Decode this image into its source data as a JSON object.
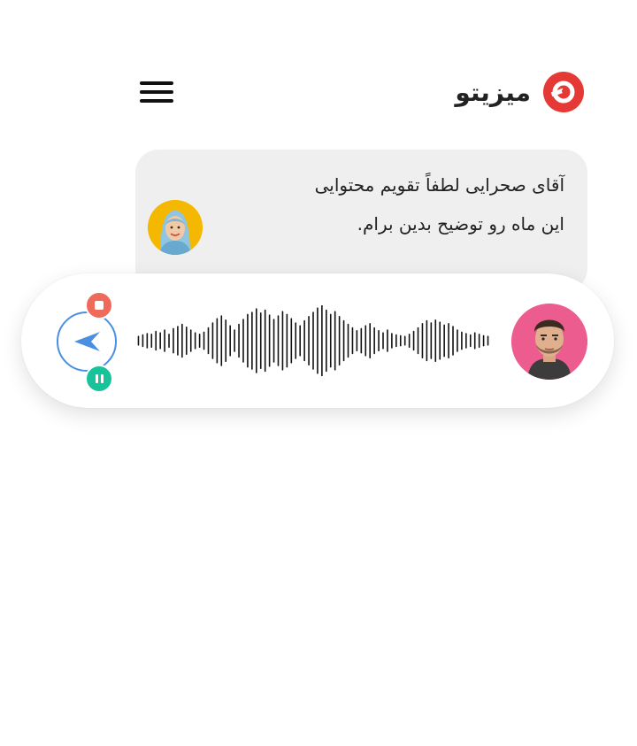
{
  "header": {
    "brand_name": "میزیتو",
    "menu_icon": "hamburger-menu-icon",
    "logo_icon": "mizito-logo-icon",
    "brand_color": "#e53935"
  },
  "message": {
    "line1": "آقای صحرایی لطفاً تقویم محتوایی",
    "line2": "این ماه رو توضیح بدین برام.",
    "avatar_icon": "woman-hijab-avatar",
    "bubble_color": "#efefef"
  },
  "recorder": {
    "send_icon": "send-arrow-icon",
    "stop_icon": "stop-icon",
    "pause_icon": "pause-icon",
    "waveform_icon": "audio-waveform",
    "user_avatar_icon": "man-avatar",
    "colors": {
      "send_border": "#4a90e2",
      "stop": "#ef6a5a",
      "pause": "#19c39a",
      "avatar_bg": "#ec5c8f"
    },
    "waveform_levels": [
      0.12,
      0.16,
      0.2,
      0.18,
      0.26,
      0.22,
      0.3,
      0.18,
      0.34,
      0.4,
      0.46,
      0.38,
      0.3,
      0.22,
      0.18,
      0.24,
      0.36,
      0.5,
      0.62,
      0.7,
      0.58,
      0.42,
      0.3,
      0.46,
      0.6,
      0.74,
      0.8,
      0.9,
      0.78,
      0.86,
      0.72,
      0.6,
      0.7,
      0.82,
      0.74,
      0.62,
      0.5,
      0.42,
      0.56,
      0.68,
      0.8,
      0.92,
      1.0,
      0.86,
      0.74,
      0.82,
      0.68,
      0.56,
      0.46,
      0.36,
      0.28,
      0.34,
      0.42,
      0.48,
      0.36,
      0.28,
      0.22,
      0.3,
      0.2,
      0.16,
      0.14,
      0.12,
      0.18,
      0.26,
      0.36,
      0.48,
      0.56,
      0.5,
      0.58,
      0.52,
      0.44,
      0.48,
      0.4,
      0.3,
      0.24,
      0.2,
      0.16,
      0.22,
      0.18,
      0.14,
      0.12
    ]
  }
}
